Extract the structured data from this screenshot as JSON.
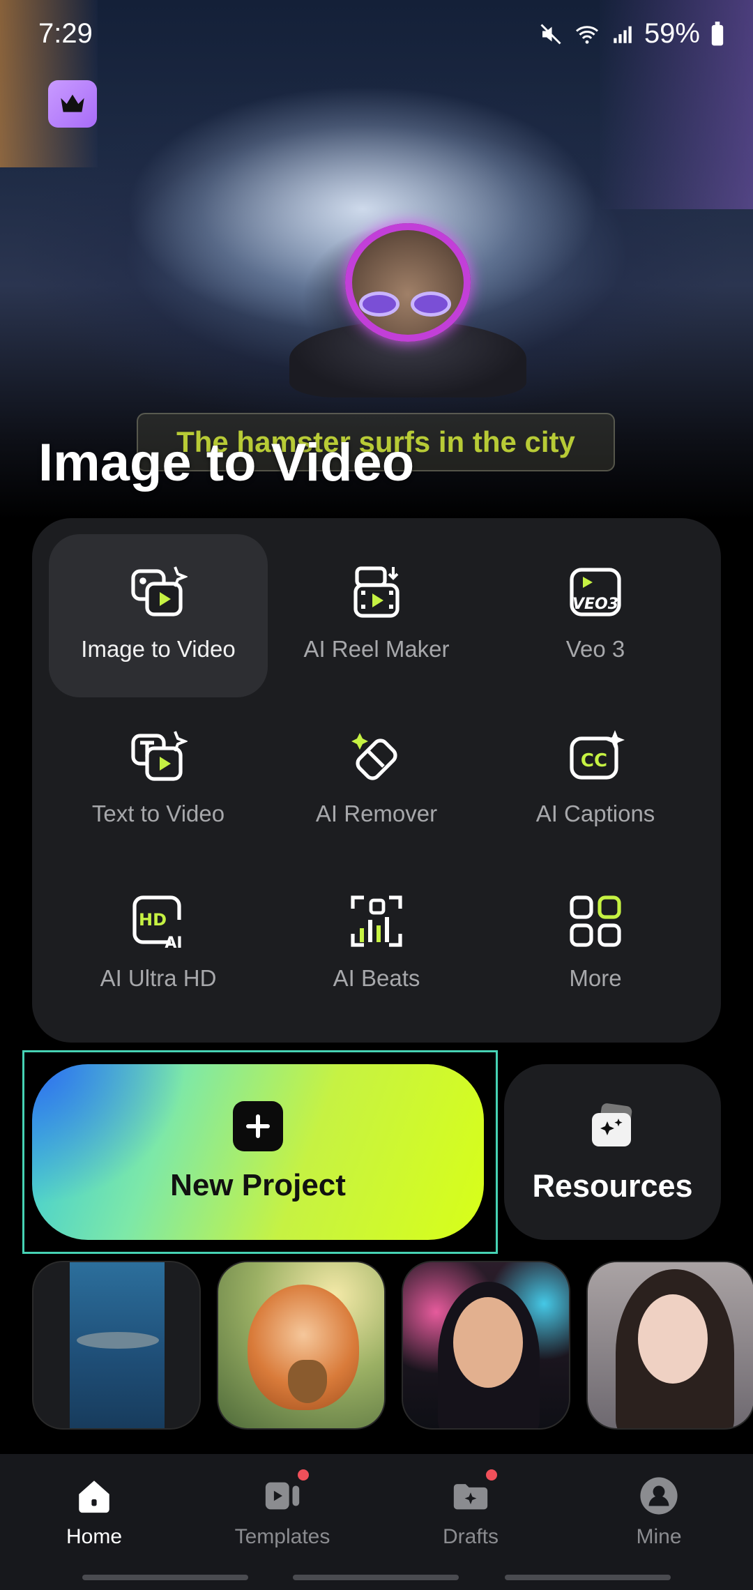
{
  "status": {
    "time": "7:29",
    "battery": "59%"
  },
  "hero": {
    "title": "Image to Video",
    "caption": "The hamster surfs in the city"
  },
  "tools": [
    {
      "label": "Image to Video",
      "icon": "image-to-video-icon",
      "selected": true
    },
    {
      "label": "AI Reel Maker",
      "icon": "reel-maker-icon",
      "selected": false
    },
    {
      "label": "Veo 3",
      "icon": "veo3-icon",
      "selected": false
    },
    {
      "label": "Text to Video",
      "icon": "text-to-video-icon",
      "selected": false
    },
    {
      "label": "AI Remover",
      "icon": "eraser-icon",
      "selected": false
    },
    {
      "label": "AI Captions",
      "icon": "captions-icon",
      "selected": false
    },
    {
      "label": "AI Ultra HD",
      "icon": "hd-ai-icon",
      "selected": false
    },
    {
      "label": "AI Beats",
      "icon": "beats-icon",
      "selected": false
    },
    {
      "label": "More",
      "icon": "grid-icon",
      "selected": false
    }
  ],
  "actions": {
    "new_project": "New Project",
    "resources": "Resources"
  },
  "nav": [
    {
      "label": "Home",
      "icon": "home-icon",
      "active": true,
      "badge": false
    },
    {
      "label": "Templates",
      "icon": "templates-icon",
      "active": false,
      "badge": true
    },
    {
      "label": "Drafts",
      "icon": "drafts-icon",
      "active": false,
      "badge": true
    },
    {
      "label": "Mine",
      "icon": "profile-icon",
      "active": false,
      "badge": false
    }
  ],
  "colors": {
    "accent_green": "#C6F243",
    "badge_red": "#F0505A",
    "focus_outline": "#46D2B4"
  }
}
